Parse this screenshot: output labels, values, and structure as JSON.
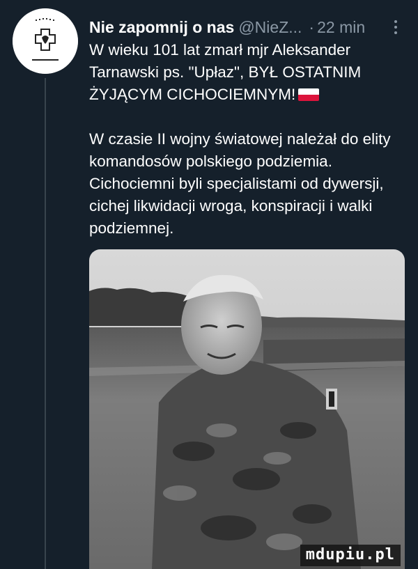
{
  "tweet": {
    "author_name": "Nie zapomnij o nas",
    "handle": "@NieZ...",
    "separator": "·",
    "time": "22 min",
    "text_line1": "W wieku 101 lat zmarł mjr Aleksander Tarnawski ps. \"Upłaz\", BYŁ OSTATNIM ŻYJĄCYM CICHOCIEMNYM!",
    "text_paragraph2": "W czasie II wojny światowej należał do elity komandosów polskiego podziemia. Cichociemni byli specjalistami od dywersji, cichej likwidacji wroga, konspiracji i walki podziemnej.",
    "flag_icon": "poland-flag-emoji"
  },
  "avatar": {
    "top_text": "FUNDACJA",
    "bottom_text": "NIE ZAPOMNIJ O NAS",
    "icon": "eagle-cross-icon"
  },
  "photo": {
    "watermark": "mdupiu.pl"
  },
  "colors": {
    "background": "#15202b",
    "secondary_text": "#8b98a5",
    "thread_line": "#38444d",
    "flag_red": "#dc143c"
  }
}
